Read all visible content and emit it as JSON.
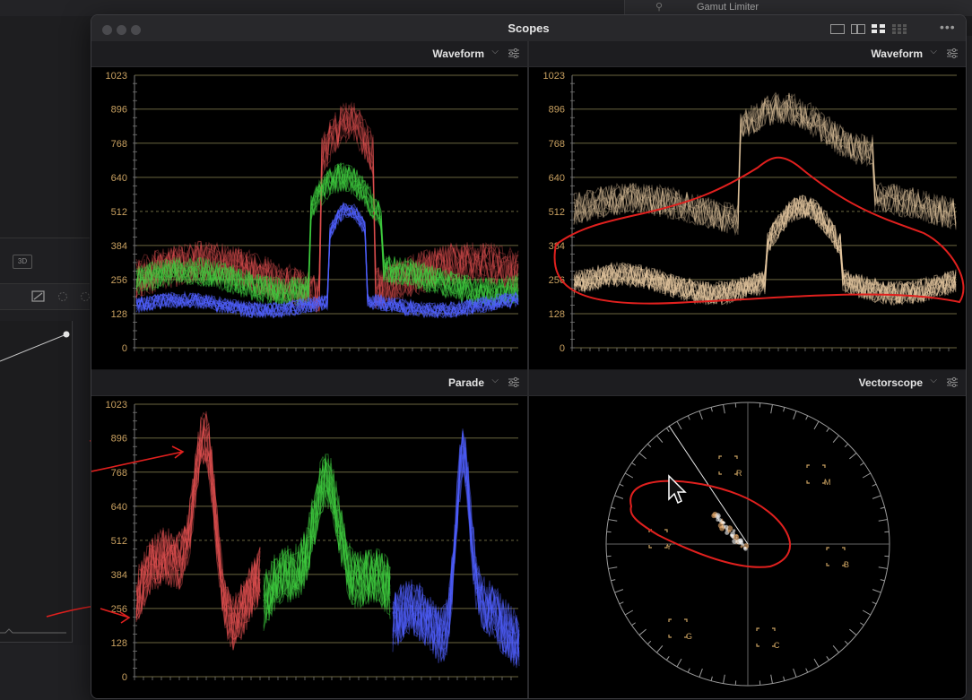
{
  "background": {
    "gamut_label": "Gamut Limiter",
    "btn_3d": "3D"
  },
  "window": {
    "title": "Scopes",
    "layout_icons": [
      "single-layout-icon",
      "dual-layout-icon",
      "quad-layout-icon",
      "grid-layout-icon"
    ],
    "more_label": "•••"
  },
  "panes": [
    {
      "title": "Waveform",
      "type": "waveform-rgb"
    },
    {
      "title": "Waveform",
      "type": "waveform-luma"
    },
    {
      "title": "Parade",
      "type": "parade"
    },
    {
      "title": "Vectorscope",
      "type": "vectorscope"
    }
  ],
  "scale_ticks": [
    "1023",
    "896",
    "768",
    "640",
    "512",
    "384",
    "256",
    "128",
    "0"
  ],
  "vectorscope_targets": [
    "R",
    "M",
    "Y",
    "B",
    "G",
    "C"
  ],
  "colors": {
    "scale_text": "#c8a060",
    "graticule": "#6b6640",
    "annotation": "#e0201e",
    "red_trace": "#e05050",
    "green_trace": "#40d040",
    "blue_trace": "#5060ff",
    "luma_trace": "#e6c8a0"
  }
}
